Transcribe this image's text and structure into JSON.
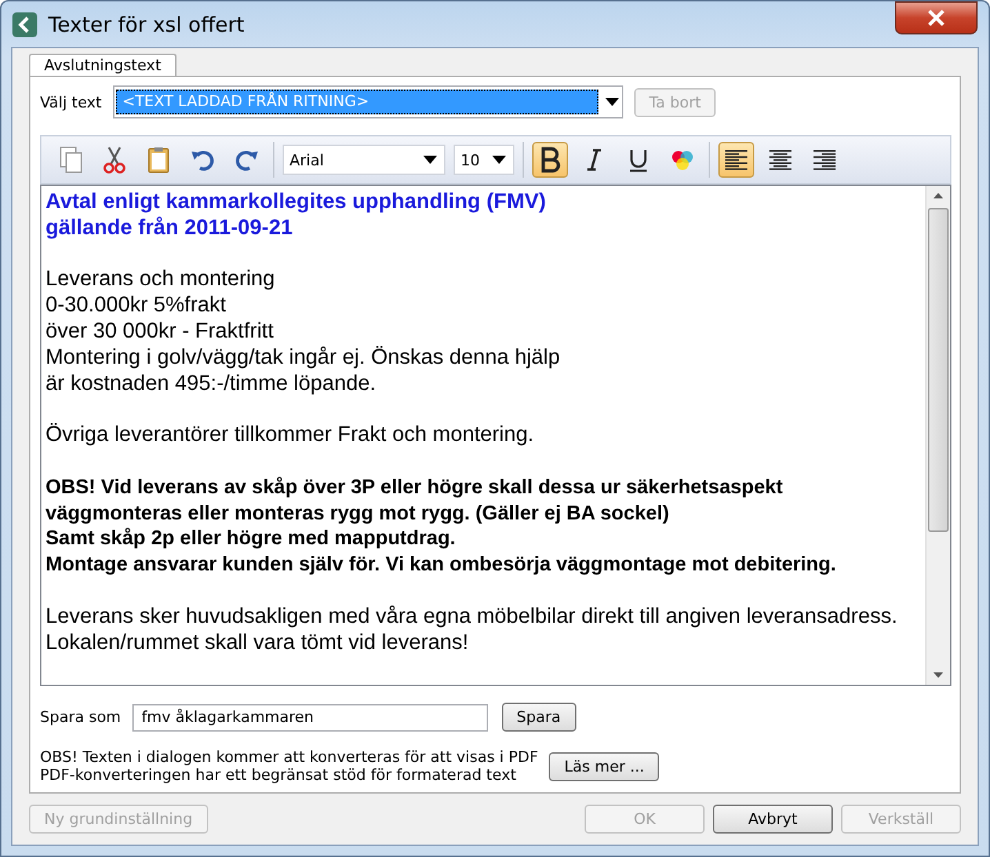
{
  "window": {
    "title": "Texter för xsl offert"
  },
  "group": {
    "label": "Avslutningstext"
  },
  "text_select": {
    "label": "Välj text",
    "value": "<TEXT LADDAD FRÅN RITNING>"
  },
  "delete_button": {
    "label": "Ta bort",
    "disabled": true
  },
  "toolbar": {
    "font": "Arial",
    "size": "10",
    "bold": true,
    "italic": false,
    "underline": false,
    "align": [
      {
        "kind": "left",
        "selected": true
      },
      {
        "kind": "center",
        "selected": false
      },
      {
        "kind": "right",
        "selected": false
      }
    ]
  },
  "editor": {
    "paragraphs": [
      {
        "kind": "heading",
        "lines": [
          "Avtal enligt kammarkollegites upphandling (FMV)",
          "gällande från 2011-09-21"
        ]
      },
      {
        "kind": "normal",
        "lines": [
          "Leverans och montering",
          "0-30.000kr 5%frakt",
          "över 30 000kr - Fraktfritt",
          "Montering i golv/vägg/tak ingår ej. Önskas denna hjälp",
          "är kostnaden 495:-/timme löpande."
        ]
      },
      {
        "kind": "normal",
        "lines": [
          "Övriga leverantörer tillkommer Frakt och montering."
        ]
      },
      {
        "kind": "bold",
        "lines": [
          "OBS! Vid leverans av skåp över 3P eller högre skall dessa ur säkerhetsaspekt",
          "väggmonteras eller monteras rygg mot rygg. (Gäller ej BA sockel)",
          "Samt skåp 2p eller högre med mapputdrag.",
          "Montage ansvarar kunden själv för. Vi kan ombesörja väggmontage mot debitering."
        ]
      },
      {
        "kind": "normal",
        "lines": [
          "Leverans sker huvudsakligen med våra egna möbelbilar direkt till angiven leveransadress.",
          "Lokalen/rummet skall vara tömt vid leverans!"
        ]
      }
    ]
  },
  "save_as": {
    "label": "Spara som",
    "value": "fmv åklagarkammaren",
    "button": "Spara"
  },
  "notice": {
    "lines": [
      "OBS! Texten i dialogen kommer att konverteras för att visas i PDF",
      "PDF-konverteringen har ett begränsat stöd för formaterad text"
    ],
    "button": "Läs mer ..."
  },
  "footer": {
    "buttons": [
      {
        "label": "Ny grundinställning",
        "disabled": true,
        "kind": "left"
      },
      {
        "label": "OK",
        "disabled": true,
        "kind": "right"
      },
      {
        "label": "Avbryt",
        "disabled": false,
        "kind": "right"
      },
      {
        "label": "Verkställ",
        "disabled": true,
        "kind": "right"
      }
    ]
  }
}
